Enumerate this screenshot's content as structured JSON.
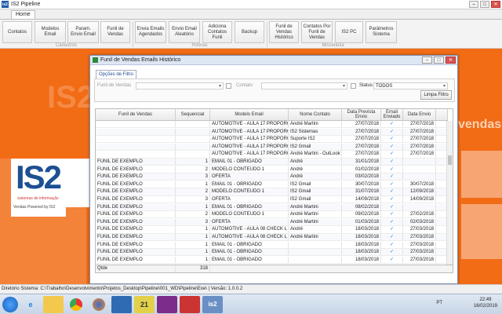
{
  "app": {
    "logo": "is2",
    "title": "IS2 Pipeline",
    "home_tab": "Home"
  },
  "ribbon": {
    "buttons": [
      "Contatos",
      "Modelos\nEmail",
      "Param.\nEnvio Email",
      "Funil de\nVendas",
      "Envia Emails\nAgendados",
      "Envio Email\nAleatório",
      "Adiciona\nContatos\nFunil",
      "Backup",
      "Funil de\nVendas\nHistórico",
      "Contatos Por\nFunil de\nVendas",
      "IS2 PC",
      "Parâmetros\nSistema"
    ],
    "groups": [
      "Cadastros",
      "Rotinas",
      "Miscelânia"
    ]
  },
  "background": {
    "brand": "IS2",
    "tagline": "vendas",
    "logo_sub": "sistemas de informação",
    "vendas_logo": "Vendas Powered by IS2"
  },
  "modal": {
    "title": "Funil de Vendas Emails Histórico",
    "tab": "Opções de Filtro",
    "filters": {
      "funil_label": "Funil de Vendas",
      "contato_label": "Contato",
      "status_label": "Status",
      "status_value": "TODOS",
      "clear_button": "Limpa Filtro"
    },
    "columns": [
      "Funil de Vendas",
      "Sequencial",
      "Modelo Email",
      "Nome Contato",
      "Data Prevista\nEnvio",
      "Email\nEnviado",
      "Data Envio"
    ],
    "rows": [
      [
        "",
        "",
        "AUTOMOTIVE - AULA 17 PROPORC",
        "André Martini",
        "27/07/2018",
        "✓",
        "27/07/2018"
      ],
      [
        "",
        "",
        "AUTOMOTIVE - AULA 17 PROPORC",
        "IS2 Sistemas",
        "27/07/2018",
        "✓",
        "27/07/2018"
      ],
      [
        "",
        "",
        "AUTOMOTIVE - AULA 17 PROPORC",
        "Suporte IS2",
        "27/07/2018",
        "✓",
        "27/07/2018"
      ],
      [
        "",
        "",
        "AUTOMOTIVE - AULA 17 PROPORC",
        "IS2 Gmail",
        "27/07/2018",
        "✓",
        "27/07/2018"
      ],
      [
        "",
        "",
        "AUTOMOTIVE - AULA 17 PROPORC",
        "André Martini - OutLook",
        "27/07/2018",
        "✓",
        "27/07/2018"
      ],
      [
        "FUNIL DE EXEMPLO",
        "1",
        "EMAIL 01 - OBRIGADO",
        "André",
        "31/01/2018",
        "✓",
        ""
      ],
      [
        "FUNIL DE EXEMPLO",
        "2",
        "MODELO CONTEUDO 1",
        "André",
        "01/02/2018",
        "✓",
        ""
      ],
      [
        "FUNIL DE EXEMPLO",
        "3",
        "OFERTA",
        "André",
        "03/02/2018",
        "✓",
        ""
      ],
      [
        "FUNIL DE EXEMPLO",
        "1",
        "EMAIL 01 - OBRIGADO",
        "IS2 Gmail",
        "30/07/2018",
        "✓",
        "30/07/2018"
      ],
      [
        "FUNIL DE EXEMPLO",
        "2",
        "MODELO CONTEUDO 1",
        "IS2 Gmail",
        "31/07/2018",
        "✓",
        "12/09/2018"
      ],
      [
        "FUNIL DE EXEMPLO",
        "3",
        "OFERTA",
        "IS2 Gmail",
        "14/09/2018",
        "✓",
        "14/09/2018"
      ],
      [
        "FUNIL DE EXEMPLO",
        "1",
        "EMAIL 01 - OBRIGADO",
        "André Martini",
        "08/02/2018",
        "✓",
        ""
      ],
      [
        "FUNIL DE EXEMPLO",
        "2",
        "MODELO CONTEUDO 1",
        "André Martini",
        "09/02/2018",
        "✓",
        "27/02/2018"
      ],
      [
        "FUNIL DE EXEMPLO",
        "3",
        "OFERTA",
        "André Martini",
        "01/03/2018",
        "✓",
        "02/03/2018"
      ],
      [
        "FUNIL DE EXEMPLO",
        "1",
        "AUTOMOTIVE - AULA 08 CHECK L",
        "André",
        "18/03/2018",
        "✓",
        "27/03/2018"
      ],
      [
        "FUNIL DE EXEMPLO",
        "1",
        "AUTOMOTIVE - AULA 08 CHECK L",
        "André Martini",
        "18/03/2018",
        "✓",
        "27/03/2018"
      ],
      [
        "FUNIL DE EXEMPLO",
        "1",
        "EMAIL 01 - OBRIGADO",
        "",
        "18/03/2018",
        "✓",
        "27/03/2018"
      ],
      [
        "FUNIL DE EXEMPLO",
        "1",
        "EMAIL 01 - OBRIGADO",
        "",
        "18/03/2018",
        "✓",
        "27/03/2018"
      ],
      [
        "FUNIL DE EXEMPLO",
        "1",
        "EMAIL 01 - OBRIGADO",
        "",
        "18/03/2018",
        "✓",
        "27/03/2018"
      ]
    ],
    "footer": {
      "label": "Qtde",
      "count": "318"
    }
  },
  "statusbar": "Diretório Sistema: C:\\Trabalho\\Desenvolvimento\\Projetos_Desktop\\Pipeline\\001_WD\\Pipeline\\Exe\\ | Versão: 1.0.0.2",
  "taskbar": {
    "lang": "PT",
    "time": "22:49",
    "date": "16/02/2019",
    "icons": [
      "start-icon",
      "ie-icon",
      "explorer-icon",
      "chrome-icon",
      "firefox-icon",
      "app-icon",
      "app21-icon",
      "windev-icon",
      "wd-icon",
      "is2-icon"
    ]
  }
}
